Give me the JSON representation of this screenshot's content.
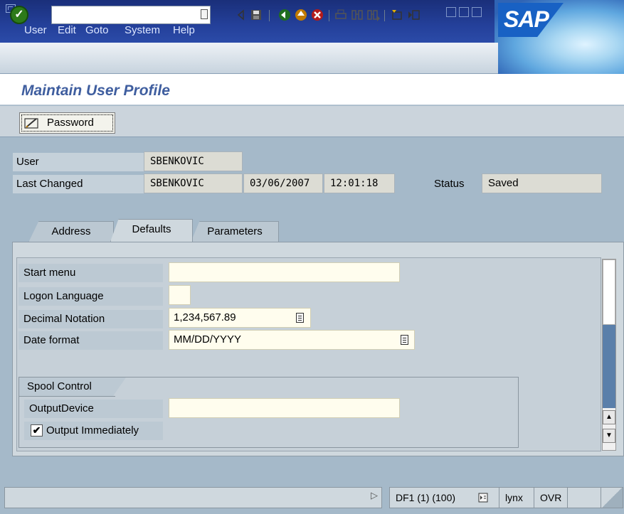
{
  "menu": {
    "items": [
      "User",
      "Edit",
      "Goto",
      "System",
      "Help"
    ],
    "underlined": [
      "U",
      "E",
      "G",
      "y",
      "H"
    ]
  },
  "brand": {
    "logo_text": "SAP",
    "color": "#1861c4"
  },
  "toolbar": {
    "command_field_value": "",
    "icons": [
      "ok-icon",
      "command-help-icon",
      "collapse-icon",
      "save-icon",
      "back-icon",
      "exit-icon",
      "cancel-icon",
      "print-icon",
      "find-icon",
      "find-next-icon",
      "new-session-icon",
      "generate-shortcut-icon"
    ]
  },
  "screen": {
    "title": "Maintain User Profile"
  },
  "app_toolbar": {
    "password_label": "Password"
  },
  "header": {
    "user_label": "User",
    "user_value": "SBENKOVIC",
    "last_changed_label": "Last Changed",
    "last_changed_user": "SBENKOVIC",
    "last_changed_date": "03/06/2007",
    "last_changed_time": "12:01:18",
    "status_label": "Status",
    "status_value": "Saved"
  },
  "tabs": [
    {
      "label": "Address",
      "active": false
    },
    {
      "label": "Defaults",
      "active": true
    },
    {
      "label": "Parameters",
      "active": false
    }
  ],
  "defaults": {
    "start_menu_label": "Start menu",
    "start_menu_value": "",
    "logon_language_label": "Logon Language",
    "logon_language_value": "",
    "decimal_notation_label": "Decimal Notation",
    "decimal_notation_value": "1,234,567.89",
    "date_format_label": "Date format",
    "date_format_value": "MM/DD/YYYY"
  },
  "spool": {
    "group_label": "Spool Control",
    "output_device_label": "OutputDevice",
    "output_device_value": "",
    "output_immediately_label": "Output Immediately",
    "output_immediately_checked": true,
    "check_mark": "✔"
  },
  "status_bar": {
    "system": "DF1 (1) (100)",
    "server": "lynx",
    "mode": "OVR"
  },
  "colors": {
    "title": "#3f5e9f",
    "background": "#a5b9c9",
    "input_background": "#fffdee"
  }
}
